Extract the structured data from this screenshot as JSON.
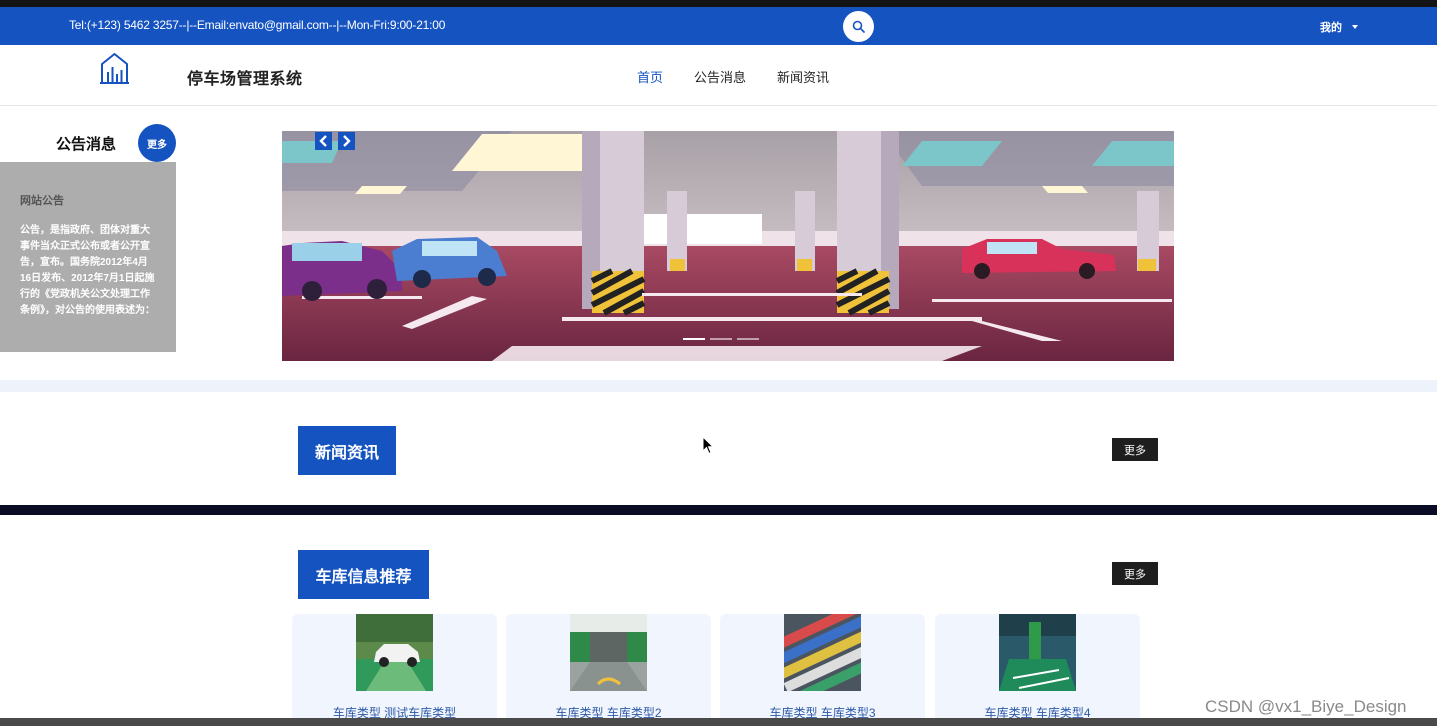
{
  "topbar": {
    "contact": "Tel:(+123) 5462 3257--|--Email:envato@gmail.com--|--Mon-Fri:9:00-21:00",
    "search_icon": "search-icon",
    "mine_label": "我的"
  },
  "header": {
    "site_title": "停车场管理系统",
    "logo_icon": "building-chart-icon",
    "nav": [
      "首页",
      "公告消息",
      "新闻资讯"
    ],
    "active_nav": "首页"
  },
  "notice": {
    "title": "公告消息",
    "more_label": "更多",
    "item_heading": "网站公告",
    "item_body": "公告，是指政府、团体对重大事件当众正式公布或者公开宣告，宣布。国务院2012年4月16日发布、2012年7月1日起施行的《党政机关公文处理工作条例》，对公告的使用表述为："
  },
  "banner": {
    "prev_icon": "chevron-left-icon",
    "next_icon": "chevron-right-icon",
    "slide_count": 3,
    "active_slide": 1
  },
  "news": {
    "title": "新闻资讯",
    "more_label": "更多"
  },
  "garage": {
    "title": "车库信息推荐",
    "more_label": "更多",
    "cards": [
      {
        "caption": "车库类型 测试车库类型"
      },
      {
        "caption": "车库类型 车库类型2"
      },
      {
        "caption": "车库类型 车库类型3"
      },
      {
        "caption": "车库类型 车库类型4"
      }
    ]
  },
  "watermark": "CSDN @vx1_Biye_Design",
  "colors": {
    "brand_blue": "#1553c1",
    "dark_button": "#1e1e1e",
    "notice_gray": "#adadad"
  }
}
